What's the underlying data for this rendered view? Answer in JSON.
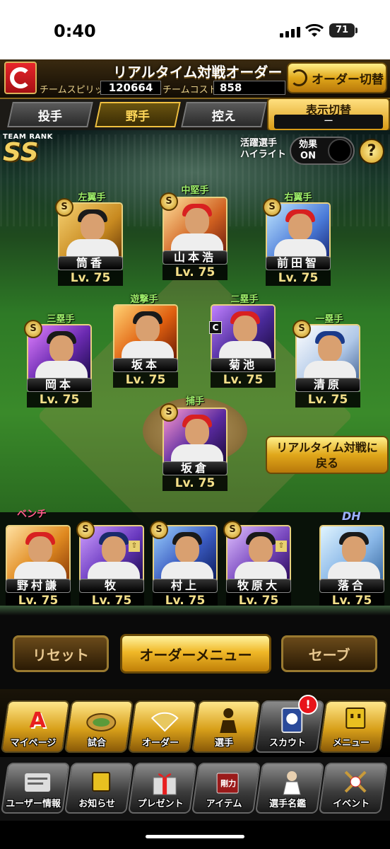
{
  "status_bar": {
    "time": "0:40",
    "battery": "71"
  },
  "header": {
    "title": "リアルタイム対戦オーダー",
    "spirits_label": "チームスピリッツ",
    "spirits_value": "120664",
    "cost_label": "チームコスト",
    "cost_value": "858",
    "order_switch_label": "オーダー切替"
  },
  "tabs": [
    {
      "label": "投手",
      "active": false
    },
    {
      "label": "野手",
      "active": true
    },
    {
      "label": "控え",
      "active": false
    }
  ],
  "display_switch": {
    "label": "表示切替",
    "value": "ー"
  },
  "team_rank": {
    "label": "TEAM RANK",
    "rank": "SS"
  },
  "highlight": {
    "label_line1": "活躍選手",
    "label_line2": "ハイライト",
    "effect_line1": "効果",
    "effect_line2": "ON"
  },
  "help_icon": "?",
  "positions": {
    "left_field": "左翼手",
    "center_field": "中堅手",
    "right_field": "右翼手",
    "shortstop": "遊撃手",
    "second_base": "二塁手",
    "third_base": "三塁手",
    "first_base": "一塁手",
    "catcher": "捕手"
  },
  "starters": [
    {
      "name": "筒香",
      "level": "Lv. 75"
    },
    {
      "name": "山本浩",
      "level": "Lv. 75"
    },
    {
      "name": "前田智",
      "level": "Lv. 75"
    },
    {
      "name": "坂本",
      "level": "Lv. 75"
    },
    {
      "name": "菊池",
      "level": "Lv. 75"
    },
    {
      "name": "岡本",
      "level": "Lv. 75"
    },
    {
      "name": "清原",
      "level": "Lv. 75"
    },
    {
      "name": "坂倉",
      "level": "Lv. 75"
    }
  ],
  "bench_label": "ベンチ",
  "dh_label": "DH",
  "bench": [
    {
      "name": "野村謙",
      "level": "Lv. 75"
    },
    {
      "name": "牧",
      "level": "Lv. 75"
    },
    {
      "name": "村上",
      "level": "Lv. 75"
    },
    {
      "name": "牧原大",
      "level": "Lv. 75"
    },
    {
      "name": "落合",
      "level": "Lv. 75"
    }
  ],
  "realtime_button": {
    "line1": "リアルタイム対戦に",
    "line2": "戻る"
  },
  "actions": {
    "reset": "リセット",
    "order_menu": "オーダーメニュー",
    "save": "セーブ"
  },
  "nav_primary": [
    {
      "label": "マイページ",
      "icon": "A"
    },
    {
      "label": "試合",
      "icon": "stadium-icon"
    },
    {
      "label": "オーダー",
      "icon": "field-icon"
    },
    {
      "label": "選手",
      "icon": "player-icon"
    },
    {
      "label": "スカウト",
      "icon": "scout-card-icon"
    },
    {
      "label": "メニュー",
      "icon": "menu-icon"
    }
  ],
  "scout_notification": "!",
  "nav_secondary": [
    {
      "label": "ユーザー情報",
      "icon": "user-info-icon"
    },
    {
      "label": "お知らせ",
      "icon": "news-icon"
    },
    {
      "label": "プレゼント",
      "icon": "gift-icon"
    },
    {
      "label": "アイテム",
      "icon": "item-book-icon",
      "tag": "剛力"
    },
    {
      "label": "選手名鑑",
      "icon": "player-directory-icon"
    },
    {
      "label": "イベント",
      "icon": "event-icon"
    }
  ],
  "badge_text": {
    "s": "S",
    "c": "C",
    "up": "⇧"
  },
  "colors": {
    "gold": "#f0c040",
    "position_label": "#9ff06a",
    "level_text": "#f5e08a",
    "bench_label": "#ff5a8a",
    "dh_label": "#9bb0ff"
  }
}
